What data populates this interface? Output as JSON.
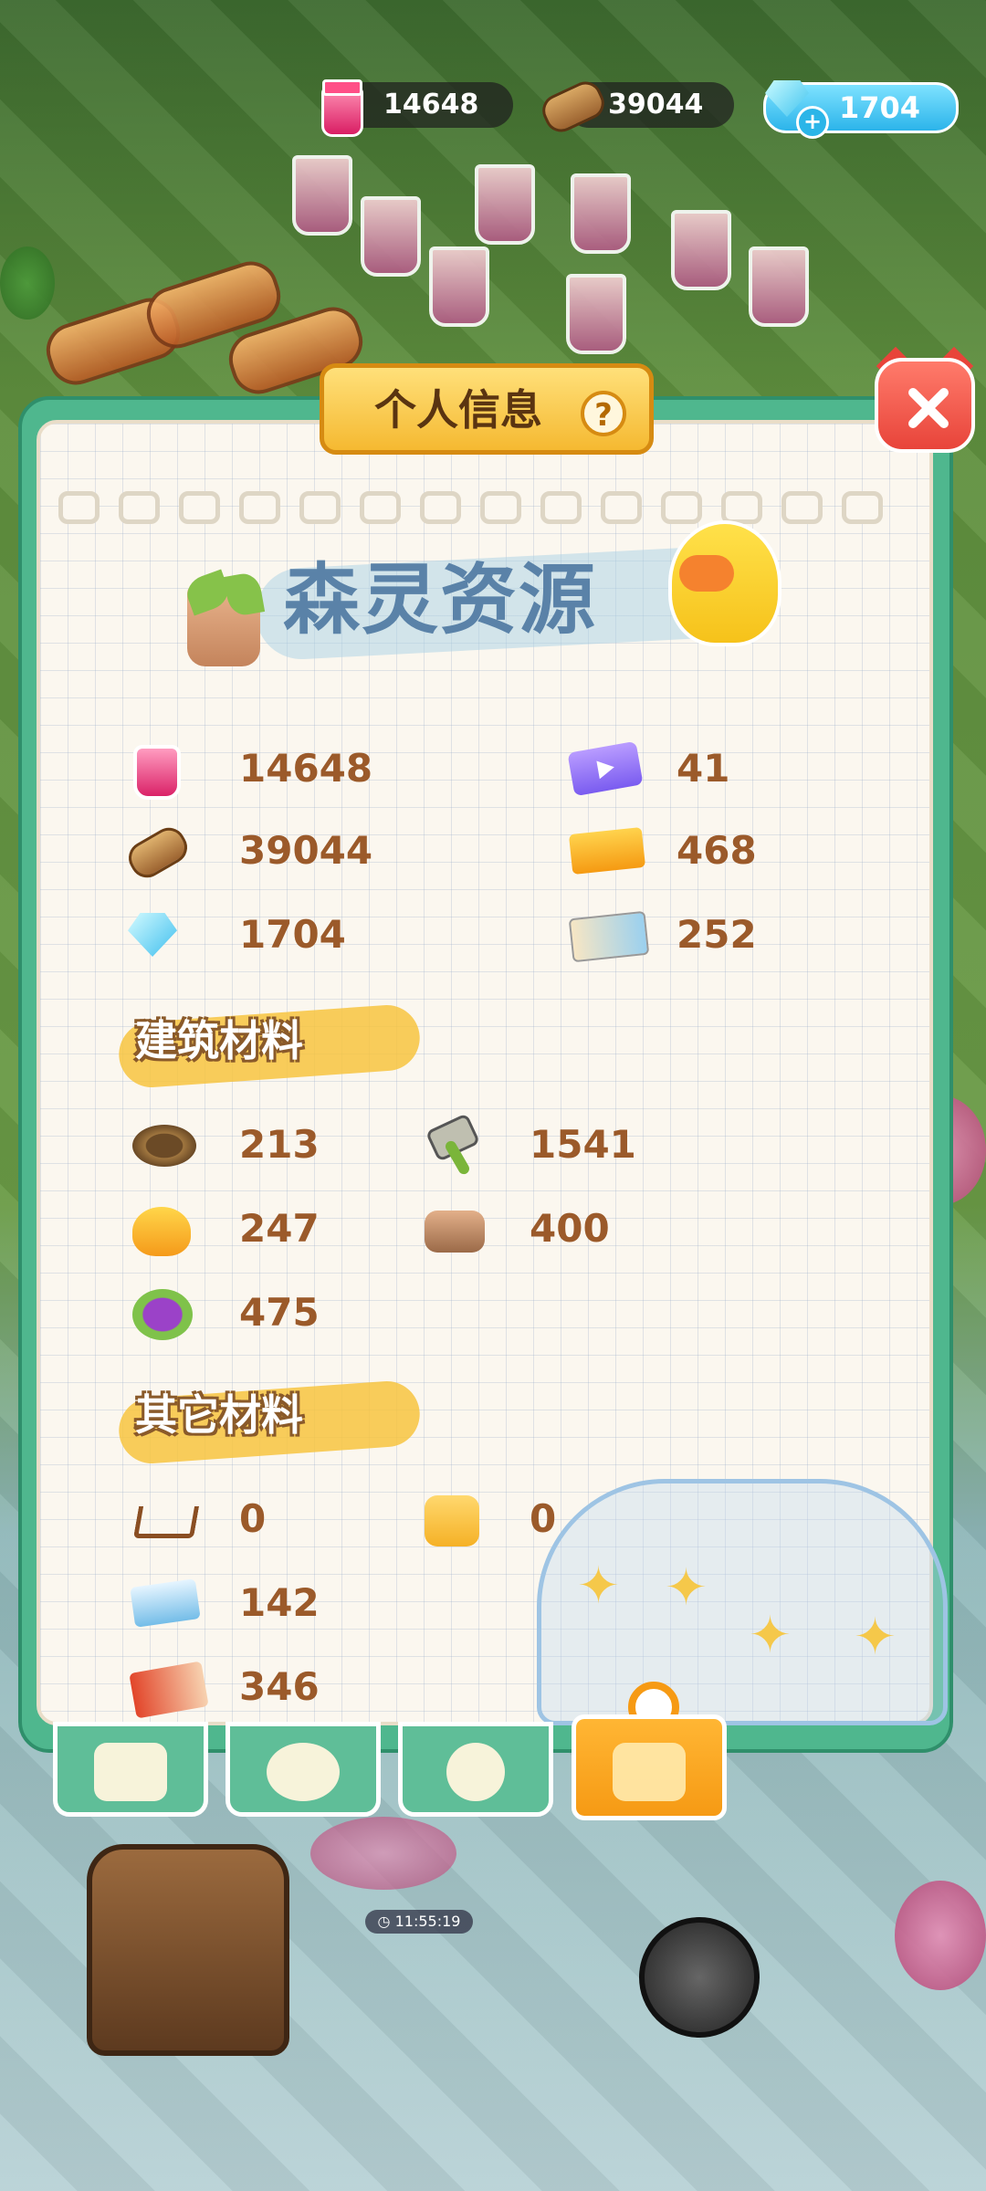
{
  "top_bar": {
    "jam": "14648",
    "wood": "39044",
    "gems": "1704",
    "gem_add": "+"
  },
  "panel": {
    "title": "个人信息",
    "help": "?",
    "section_title": "森灵资源"
  },
  "primary_resources": [
    {
      "icon": "jam-jar-icon",
      "value": "14648"
    },
    {
      "icon": "video-ticket-icon",
      "value": "41"
    },
    {
      "icon": "wood-log-icon",
      "value": "39044"
    },
    {
      "icon": "gold-ticket-icon",
      "value": "468"
    },
    {
      "icon": "gem-icon",
      "value": "1704"
    },
    {
      "icon": "paper-ticket-icon",
      "value": "252"
    }
  ],
  "building_materials": {
    "title": "建筑材料",
    "items": [
      {
        "icon": "nest-icon",
        "value": "213"
      },
      {
        "icon": "hammer-icon",
        "value": "1541"
      },
      {
        "icon": "orange-fruit-icon",
        "value": "247"
      },
      {
        "icon": "stone-icon",
        "value": "400"
      },
      {
        "icon": "purple-fruit-icon",
        "value": "475"
      }
    ]
  },
  "other_materials": {
    "title": "其它材料",
    "items": [
      {
        "icon": "hanger-icon",
        "value": "0"
      },
      {
        "icon": "bag-icon",
        "value": "0"
      },
      {
        "icon": "plane-ticket-icon",
        "value": "142"
      },
      {
        "icon": "card-pack-icon",
        "value": "346"
      }
    ]
  },
  "tabs": [
    {
      "icon": "cat-profile-icon",
      "active": false
    },
    {
      "icon": "badge-icon",
      "active": false
    },
    {
      "icon": "settings-gear-icon",
      "active": false
    },
    {
      "icon": "resources-bag-icon",
      "active": true
    }
  ],
  "timer": "11:55:19",
  "colors": {
    "panel_green": "#4fb78e",
    "title_gold": "#f5b931",
    "number_brown": "#9b5a2a",
    "close_red": "#e8443a",
    "active_tab": "#f69a14"
  }
}
